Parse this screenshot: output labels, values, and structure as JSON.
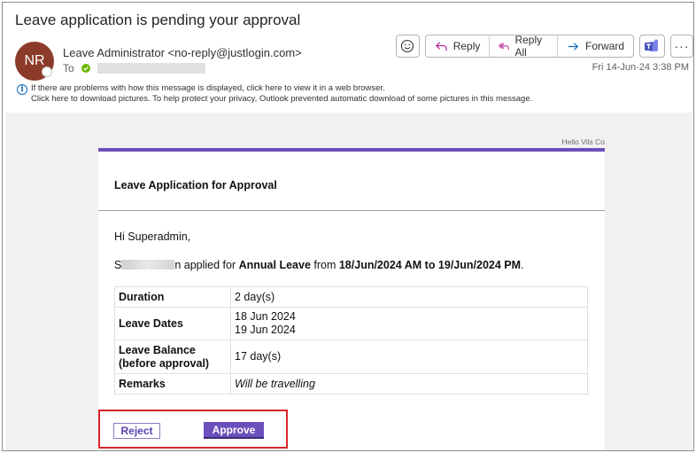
{
  "email": {
    "subject": "Leave application is pending your approval",
    "avatar_initials": "NR",
    "sender": "Leave Administrator <no-reply@justlogin.com>",
    "to_label": "To",
    "datetime": "Fri 14-Jun-24 3:38 PM"
  },
  "toolbar": {
    "emoji_icon": "smiley-icon",
    "reply_label": "Reply",
    "reply_all_label": "Reply All",
    "forward_label": "Forward",
    "teams_icon": "teams-icon",
    "more_label": "···"
  },
  "infobar": {
    "line1": "If there are problems with how this message is displayed, click here to view it in a web browser.",
    "line2": "Click here to download pictures. To help protect your privacy, Outlook prevented automatic download of some pictures in this message."
  },
  "body": {
    "hello_text": "Hello Vils Co",
    "card_title": "Leave Application for Approval",
    "greeting": "Hi Superadmin,",
    "applicant_prefix": "S",
    "applicant_suffix": "n",
    "applied_for": " applied for ",
    "leave_type": "Annual Leave",
    "from_text": " from ",
    "date_range": "18/Jun/2024 AM to 19/Jun/2024 PM",
    "period_end": ".",
    "details": {
      "duration_label": "Duration",
      "duration_value": "2 day(s)",
      "leave_dates_label": "Leave Dates",
      "leave_date_1": "18 Jun 2024",
      "leave_date_2": "19 Jun 2024",
      "balance_label_1": "Leave Balance",
      "balance_label_2": "(before approval)",
      "balance_value": "17 day(s)",
      "remarks_label": "Remarks",
      "remarks_value": "Will be travelling"
    },
    "reject_label": "Reject",
    "approve_label": "Approve"
  },
  "colors": {
    "accent_purple": "#6b4fbb",
    "highlight_red": "#d9232b",
    "avatar_bg": "#8c3b2a"
  }
}
